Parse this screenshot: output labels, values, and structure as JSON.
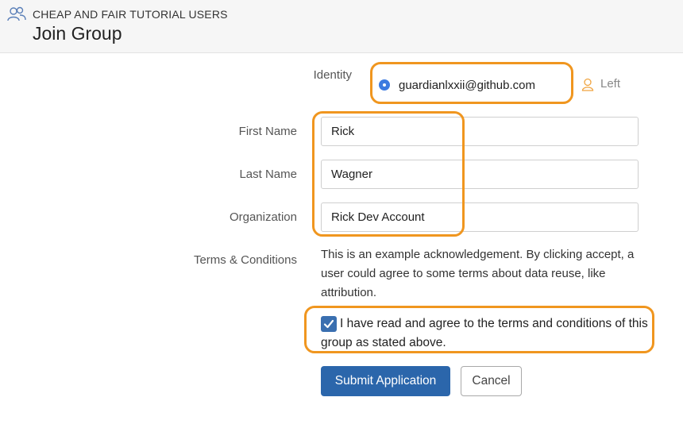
{
  "header": {
    "group_name": "CHEAP AND FAIR TUTORIAL USERS",
    "page_title": "Join Group",
    "icon": "users-icon"
  },
  "form": {
    "identity": {
      "label": "Identity",
      "selected_value": "guardianlxxii@github.com",
      "left_label": "Left",
      "left_icon": "person-icon"
    },
    "first_name": {
      "label": "First Name",
      "value": "Rick"
    },
    "last_name": {
      "label": "Last Name",
      "value": "Wagner"
    },
    "organization": {
      "label": "Organization",
      "value": "Rick Dev Account"
    },
    "terms": {
      "label": "Terms & Conditions",
      "text": "This is an example acknowledgement. By clicking accept, a user could agree to some terms about data reuse, like attribution.",
      "agree_text": "I have read and agree to the terms and conditions of this group as stated above.",
      "agree_checked": true
    }
  },
  "actions": {
    "submit_label": "Submit Application",
    "cancel_label": "Cancel"
  },
  "colors": {
    "primary": "#2b66ab",
    "highlight": "#f0961f",
    "radio": "#3d7be0"
  }
}
